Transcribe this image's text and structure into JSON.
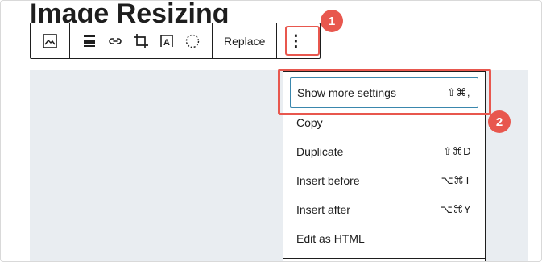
{
  "page": {
    "title": "Image Resizing"
  },
  "toolbar": {
    "image_icon": "image-icon",
    "align_icon": "align-icon",
    "link_icon": "link-icon",
    "crop_icon": "crop-icon",
    "text_overlay_icon": "text-overlay-icon",
    "select_icon": "dashed-circle-icon",
    "replace_label": "Replace",
    "more_icon": "vertical-ellipsis-icon",
    "more_glyph": "⋮"
  },
  "annotations": {
    "badge1": "1",
    "badge2": "2",
    "color": "#e8574e"
  },
  "menu": {
    "items": [
      {
        "label": "Show more settings",
        "shortcut": "⇧⌘,"
      },
      {
        "label": "Copy",
        "shortcut": ""
      },
      {
        "label": "Duplicate",
        "shortcut": "⇧⌘D"
      },
      {
        "label": "Insert before",
        "shortcut": "⌥⌘T"
      },
      {
        "label": "Insert after",
        "shortcut": "⌥⌘Y"
      },
      {
        "label": "Edit as HTML",
        "shortcut": ""
      }
    ]
  },
  "colors": {
    "focus": "#3a87ad",
    "canvas": "#e9edf1",
    "text": "#1e1e1e"
  }
}
